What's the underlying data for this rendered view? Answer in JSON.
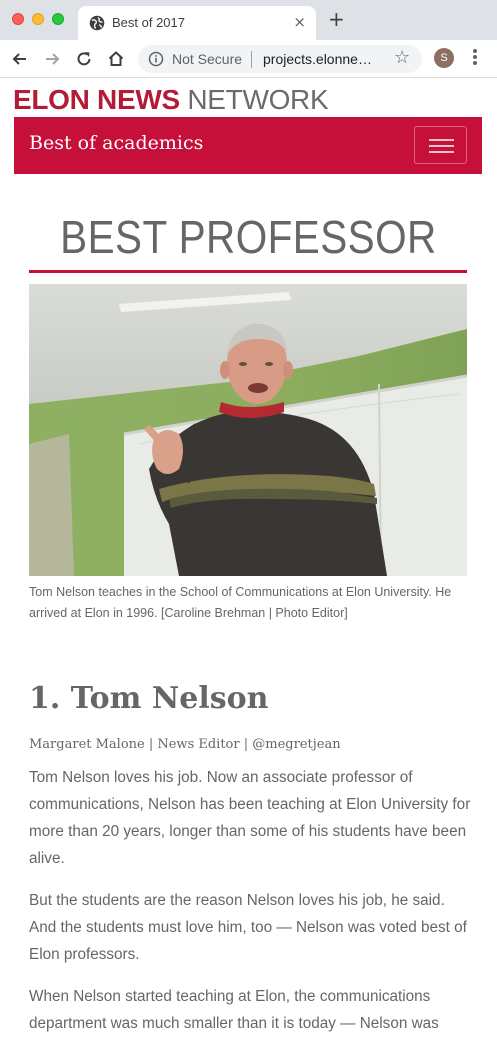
{
  "browser": {
    "tab_title": "Best of 2017",
    "new_tab_label": "+",
    "close_tab_label": "×",
    "security_label": "Not Secure",
    "url": "projects.elonne…",
    "profile_initial": "S"
  },
  "site": {
    "brand_bold": "ELON NEWS",
    "brand_light": " NETWORK",
    "brand_color": "#b41b35",
    "accent_color": "#c6103a"
  },
  "section": {
    "title": "Best of academics"
  },
  "article": {
    "headline": "BEST PROFESSOR",
    "photo_caption": "Tom Nelson teaches in the School of Communications at Elon University. He arrived at Elon in 1996. [Caroline Brehman | Photo Editor]",
    "title": "1. Tom Nelson",
    "byline": "Margaret Malone | News Editor | @megretjean",
    "paragraphs": [
      "Tom Nelson loves his job. Now an associate professor of communications, Nelson has been teaching at Elon University for more than 20 years, longer than some of his students have been alive.",
      "But the students are the reason Nelson loves his job, he said. And the students must love him, too — Nelson was voted best of Elon professors.",
      "When Nelson started teaching at Elon, the communications department was much smaller than it is today — Nelson was"
    ]
  }
}
